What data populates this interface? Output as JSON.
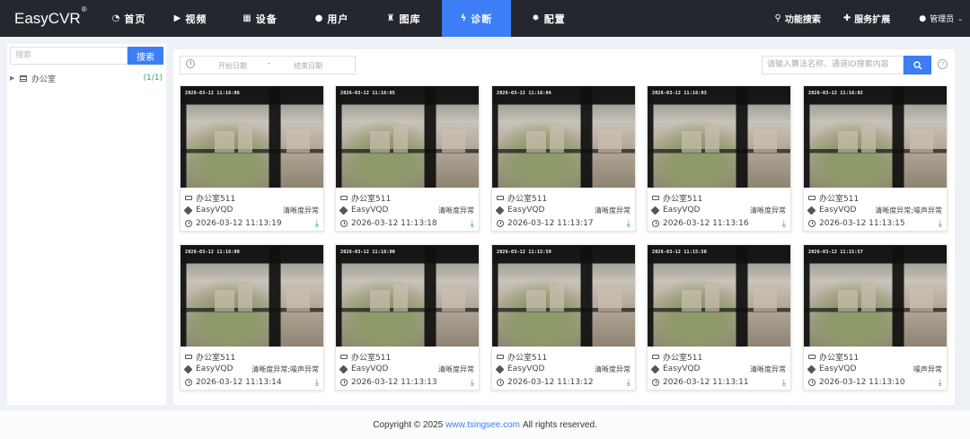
{
  "app": {
    "logo": "EasyCVR",
    "logo_mark": "®"
  },
  "nav": {
    "items": [
      {
        "label": "首页",
        "icon": "dashboard-icon",
        "active": false
      },
      {
        "label": "视频",
        "icon": "play-icon",
        "active": false
      },
      {
        "label": "设备",
        "icon": "grid-icon",
        "active": false
      },
      {
        "label": "用户",
        "icon": "user-icon",
        "active": false
      },
      {
        "label": "图库",
        "icon": "gallery-icon",
        "active": false
      },
      {
        "label": "诊断",
        "icon": "pulse-icon",
        "active": true
      },
      {
        "label": "配置",
        "icon": "gear-icon",
        "active": false
      }
    ],
    "right": {
      "search_label": "功能搜索",
      "extend_label": "服务扩展",
      "user_label": "管理员"
    }
  },
  "sidebar": {
    "search_placeholder": "搜索",
    "search_button": "搜索",
    "tree": [
      {
        "label": "办公室",
        "count": "(1/1)"
      }
    ]
  },
  "filters": {
    "start_placeholder": "开始日期",
    "separator": "-",
    "end_placeholder": "结束日期",
    "algo_placeholder": "请输入算法名称、通道ID搜索内容",
    "help": "?"
  },
  "colors": {
    "accent": "#3d7ef7",
    "nav_bg": "#25272e",
    "download": "#3aa35a"
  },
  "cards": [
    {
      "stamp": "2026-03-12  11:16:06",
      "channel": "办公室511",
      "algo": "EasyVQD",
      "result": "清晰度异常",
      "time": "2026-03-12 11:13:19"
    },
    {
      "stamp": "2026-03-12  11:16:05",
      "channel": "办公室511",
      "algo": "EasyVQD",
      "result": "清晰度异常",
      "time": "2026-03-12 11:13:18"
    },
    {
      "stamp": "2026-03-12  11:16:04",
      "channel": "办公室511",
      "algo": "EasyVQD",
      "result": "清晰度异常",
      "time": "2026-03-12 11:13:17"
    },
    {
      "stamp": "2026-03-12  11:16:03",
      "channel": "办公室511",
      "algo": "EasyVQD",
      "result": "清晰度异常",
      "time": "2026-03-12 11:13:16"
    },
    {
      "stamp": "2026-03-12  11:16:02",
      "channel": "办公室511",
      "algo": "EasyVQD",
      "result": "清晰度异常;噪声异常",
      "time": "2026-03-12 11:13:15"
    },
    {
      "stamp": "2026-03-12  11:16:00",
      "channel": "办公室511",
      "algo": "EasyVQD",
      "result": "清晰度异常;噪声异常",
      "time": "2026-03-12 11:13:14"
    },
    {
      "stamp": "2026-03-12  11:16:00",
      "channel": "办公室511",
      "algo": "EasyVQD",
      "result": "清晰度异常",
      "time": "2026-03-12 11:13:13"
    },
    {
      "stamp": "2026-03-12  11:15:59",
      "channel": "办公室511",
      "algo": "EasyVQD",
      "result": "清晰度异常",
      "time": "2026-03-12 11:13:12"
    },
    {
      "stamp": "2026-03-12  11:15:58",
      "channel": "办公室511",
      "algo": "EasyVQD",
      "result": "清晰度异常",
      "time": "2026-03-12 11:13:11"
    },
    {
      "stamp": "2026-03-12  11:15:57",
      "channel": "办公室511",
      "algo": "EasyVQD",
      "result": "噪声异常",
      "time": "2026-03-12 11:13:10"
    }
  ],
  "footer": {
    "copyright": "Copyright © 2025",
    "link": "www.tsingsee.com",
    "rights": "All rights reserved."
  }
}
